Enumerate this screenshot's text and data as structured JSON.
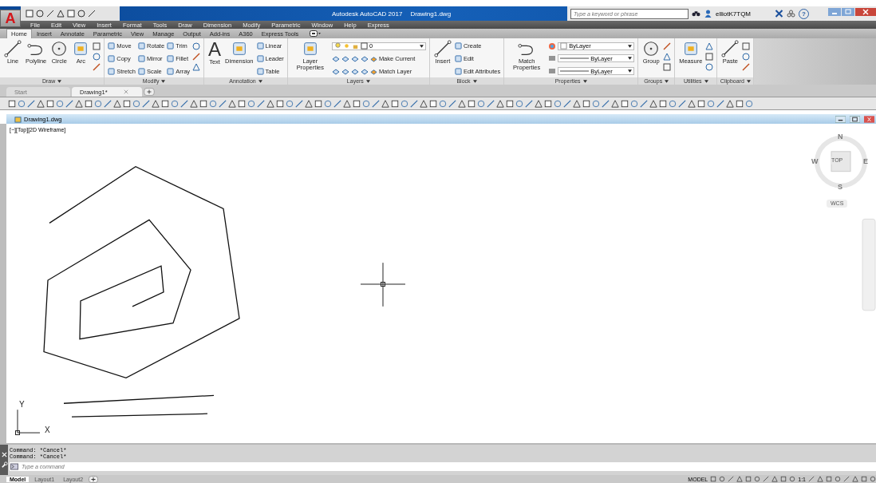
{
  "app_button": {
    "label": "A"
  },
  "title_bar": {
    "product": "Autodesk AutoCAD 2017",
    "file": "Drawing1.dwg",
    "search": {
      "placeholder": "Type a keyword or phrase"
    },
    "user": "elliotK7TQM",
    "help": "?"
  },
  "menu_bar": [
    "File",
    "Edit",
    "View",
    "Insert",
    "Format",
    "Tools",
    "Draw",
    "Dimension",
    "Modify",
    "Parametric",
    "Window",
    "Help",
    "Express"
  ],
  "ribbon_tabs": [
    {
      "label": "Home",
      "selected": true
    },
    {
      "label": "Insert",
      "selected": false
    },
    {
      "label": "Annotate",
      "selected": false
    },
    {
      "label": "Parametric",
      "selected": false
    },
    {
      "label": "View",
      "selected": false
    },
    {
      "label": "Manage",
      "selected": false
    },
    {
      "label": "Output",
      "selected": false
    },
    {
      "label": "Add-ins",
      "selected": false
    },
    {
      "label": "A360",
      "selected": false
    },
    {
      "label": "Express Tools",
      "selected": false
    }
  ],
  "ribbon_panels": [
    {
      "title": "Draw",
      "columns": [
        {
          "kind": "large",
          "label": "Line"
        },
        {
          "kind": "large",
          "label": "Polyline"
        },
        {
          "kind": "large",
          "label": "Circle"
        },
        {
          "kind": "large",
          "label": "Arc"
        },
        {
          "kind": "icons"
        }
      ]
    },
    {
      "title": "Modify",
      "columns": [
        {
          "kind": "stack",
          "items": [
            "Move",
            "Copy",
            "Stretch"
          ]
        },
        {
          "kind": "stack",
          "items": [
            "Rotate",
            "Mirror",
            "Scale"
          ]
        },
        {
          "kind": "stack",
          "items": [
            "Trim",
            "Fillet",
            "Array"
          ]
        },
        {
          "kind": "icons"
        }
      ]
    },
    {
      "title": "Annotation",
      "columns": [
        {
          "kind": "glyph",
          "glyph": "A",
          "label": "Text"
        },
        {
          "kind": "large",
          "label": "Dimension"
        },
        {
          "kind": "stack",
          "items": [
            "Linear",
            "Leader",
            "Table"
          ]
        }
      ]
    },
    {
      "title": "Layers",
      "columns": [
        {
          "kind": "large",
          "label": "Layer Properties"
        },
        {
          "kind": "layer",
          "value": "0",
          "items": [
            "Make Current",
            "Match Layer"
          ]
        }
      ]
    },
    {
      "title": "Block",
      "columns": [
        {
          "kind": "large",
          "label": "Insert"
        },
        {
          "kind": "stack",
          "items": [
            "Create",
            "Edit",
            "Edit Attributes"
          ]
        }
      ]
    },
    {
      "title": "Properties",
      "columns": [
        {
          "kind": "large",
          "label": "Match Properties"
        },
        {
          "kind": "props",
          "items": [
            "ByLayer",
            "ByLayer",
            "ByLayer"
          ]
        }
      ]
    },
    {
      "title": "Groups",
      "columns": [
        {
          "kind": "large",
          "label": "Group"
        },
        {
          "kind": "icons"
        }
      ]
    },
    {
      "title": "Utilities",
      "columns": [
        {
          "kind": "large",
          "label": "Measure"
        },
        {
          "kind": "icons"
        }
      ]
    },
    {
      "title": "Clipboard",
      "columns": [
        {
          "kind": "large",
          "label": "Paste"
        },
        {
          "kind": "icons"
        }
      ]
    }
  ],
  "document_tabs": [
    {
      "label": "Start",
      "selected": false
    },
    {
      "label": "Drawing1*",
      "selected": true
    }
  ],
  "viewport": {
    "title": "Drawing1.dwg",
    "controls": "[−][Top][2D Wireframe]",
    "viewcube": {
      "north": "N",
      "south": "S",
      "east": "E",
      "west": "W",
      "face": "TOP",
      "ucs": "WCS"
    },
    "axis_x": "X",
    "axis_y": "Y"
  },
  "command_line": {
    "history": [
      "Command: *Cancel*",
      "Command: *Cancel*"
    ],
    "placeholder": "Type a command"
  },
  "layout_tabs": [
    {
      "label": "Model",
      "selected": true
    },
    {
      "label": "Layout1",
      "selected": false
    },
    {
      "label": "Layout2",
      "selected": false
    }
  ],
  "status_bar": {
    "space": "MODEL",
    "scale": "1:1"
  }
}
